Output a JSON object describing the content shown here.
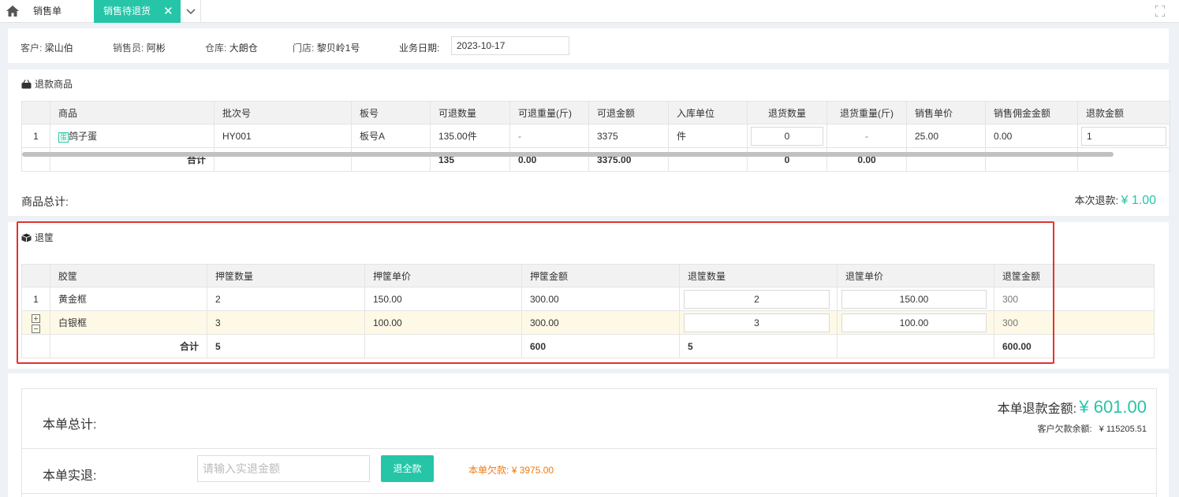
{
  "tabs": {
    "tab1": "销售单",
    "tab2": "销售待退货"
  },
  "header": {
    "customer_label": "客户:",
    "customer": "梁山伯",
    "salesperson_label": "销售员:",
    "salesperson": "阿彬",
    "warehouse_label": "仓库:",
    "warehouse": "大朗仓",
    "store_label": "门店:",
    "store": "黎贝岭1号",
    "date_label": "业务日期:",
    "date": "2023-10-17"
  },
  "refund_goods": {
    "title": "退款商品",
    "columns": [
      "商品",
      "批次号",
      "板号",
      "可退数量",
      "可退重量(斤)",
      "可退金额",
      "入库单位",
      "退货数量",
      "退货重量(斤)",
      "销售单价",
      "销售佣金金额",
      "退款金额"
    ],
    "row": {
      "index": "1",
      "tag": "蛋",
      "product": "鸽子蛋",
      "batch": "HY001",
      "board": "板号A",
      "qty": "135.00件",
      "weight": "-",
      "amount": "3375",
      "unit": "件",
      "return_qty": "0",
      "return_weight": "-",
      "price": "25.00",
      "commission": "0.00",
      "refund": "1"
    },
    "sum": {
      "label": "合计",
      "qty": "135",
      "weight": "0.00",
      "amount": "3375.00",
      "return_qty": "0",
      "return_weight": "0.00"
    },
    "footer_label": "商品总计:",
    "this_refund_label": "本次退款:",
    "this_refund_value": "¥ 1.00"
  },
  "baskets": {
    "title": "退筐",
    "columns": [
      "胶筐",
      "押筐数量",
      "押筐单价",
      "押筐金额",
      "退筐数量",
      "退筐单价",
      "退筐金额"
    ],
    "rows": [
      {
        "index": "1",
        "name": "黄金框",
        "deposit_qty": "2",
        "deposit_price": "150.00",
        "deposit_amount": "300.00",
        "return_qty": "2",
        "return_price": "150.00",
        "return_amount": "300"
      },
      {
        "index": "",
        "name": "白银框",
        "deposit_qty": "3",
        "deposit_price": "100.00",
        "deposit_amount": "300.00",
        "return_qty": "3",
        "return_price": "100.00",
        "return_amount": "300"
      }
    ],
    "sum": {
      "label": "合计",
      "deposit_qty": "5",
      "deposit_amount": "600",
      "return_qty": "5",
      "return_amount": "600.00"
    }
  },
  "summary": {
    "total_label": "本单总计:",
    "refund_label": "本单退款金额:",
    "refund_value": "¥ 601.00",
    "debt_balance_label": "客户欠款余额:",
    "debt_balance_value": "¥ 115205.51",
    "actual_label": "本单实退:",
    "actual_placeholder": "请输入实退金额",
    "full_refund_button": "退全款",
    "owed_label": "本单欠款:",
    "owed_value": "¥ 3975.00"
  }
}
